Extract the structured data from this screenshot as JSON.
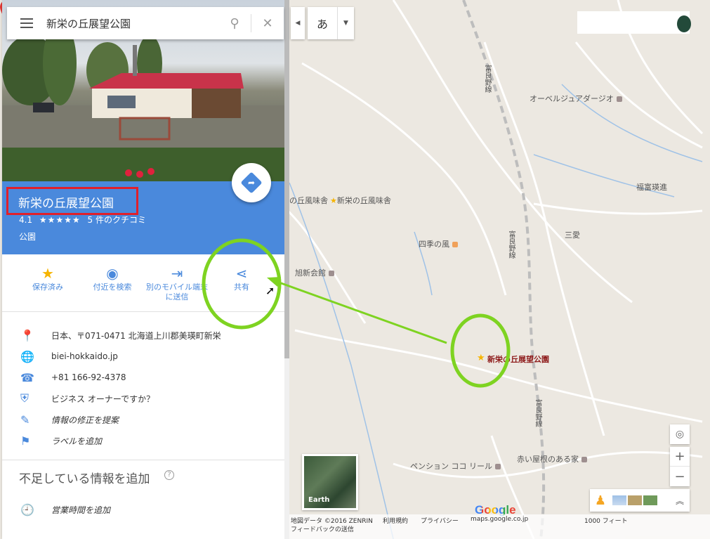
{
  "search": {
    "query": "新栄の丘展望公園"
  },
  "place": {
    "title": "新栄の丘展望公園",
    "rating": "4.1",
    "stars": "★★★★★",
    "reviews": "5 件のクチコミ",
    "category": "公園",
    "route_label": "ルート・乗換"
  },
  "actions": [
    {
      "label": "保存済み",
      "icon": "star-icon"
    },
    {
      "label": "付近を検索",
      "icon": "nearby-icon"
    },
    {
      "label": "別のモバイル端末に送信",
      "icon": "send-to-device-icon"
    },
    {
      "label": "共有",
      "icon": "share-icon"
    }
  ],
  "details": [
    {
      "text": "日本、〒071-0471 北海道上川郡美瑛町新栄",
      "icon": "location-pin-icon"
    },
    {
      "text": "biei-hokkaido.jp",
      "icon": "globe-icon"
    },
    {
      "text": "+81 166-92-4378",
      "icon": "phone-icon"
    },
    {
      "text": "ビジネス オーナーですか？",
      "icon": "verified-shield-icon"
    },
    {
      "text": "情報の修正を提案",
      "icon": "edit-pencil-icon"
    },
    {
      "text": "ラベルを追加",
      "icon": "flag-icon"
    }
  ],
  "missing": {
    "title": "不足している情報を追加",
    "help": "?",
    "hours": "営業時間を追加"
  },
  "ime": {
    "char": "あ"
  },
  "map": {
    "labels": {
      "obel": "オーベルジュアダージオ",
      "fukutomi": "福富瑛進",
      "sanai": "三愛",
      "okafumi_left": "の丘風味舎",
      "okafumi": "新栄の丘風味舎",
      "shikinokaze": "四季の風",
      "kyokushin": "旭新会館",
      "pension": "ペンション ココ リール",
      "akaiyane": "赤い屋根のある家",
      "railway_1": "富良野線",
      "railway_2": "富良野線",
      "railway_3": "富良野線"
    },
    "pin_label": "新栄の丘展望公園"
  },
  "earth_label": "Earth",
  "google_logo": "Google",
  "footer": {
    "map_data": "地図データ ©2016 ZENRIN",
    "terms": "利用規約",
    "privacy": "プライバシー",
    "domain": "maps.google.co.jp",
    "feedback": "フィードバックの送信",
    "scale": "1000 フィート"
  },
  "colors": {
    "accent": "#4a89dc",
    "annotation_red": "#e0202b",
    "annotation_green": "#7ed321",
    "pin": "#e53935"
  }
}
